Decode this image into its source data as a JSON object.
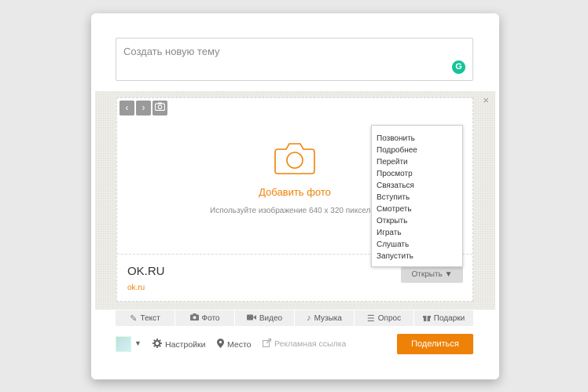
{
  "topic": {
    "placeholder": "Создать новую тему",
    "grammar_badge": "G"
  },
  "attachment": {
    "nav": {
      "prev": "‹",
      "next": "›"
    },
    "add_photo": "Добавить фото",
    "hint": "Используйте изображение 640 х 320 пиксел",
    "site_title": "OK.RU",
    "site_link": "ok.ru",
    "close": "×",
    "open_button": "Открыть ▼",
    "menu_items": [
      "Позвонить",
      "Подробнее",
      "Перейти",
      "Просмотр",
      "Связаться",
      "Вступить",
      "Смотреть",
      "Открыть",
      "Играть",
      "Слушать",
      "Запустить"
    ]
  },
  "toolbar": {
    "text": "Текст",
    "photo": "Фото",
    "video": "Видео",
    "music": "Музыка",
    "poll": "Опрос",
    "gifts": "Подарки"
  },
  "bottom": {
    "settings": "Настройки",
    "place": "Место",
    "ad_link": "Рекламная ссылка",
    "share": "Поделиться"
  },
  "colors": {
    "accent": "#ee8208",
    "grammar": "#15c39a"
  }
}
